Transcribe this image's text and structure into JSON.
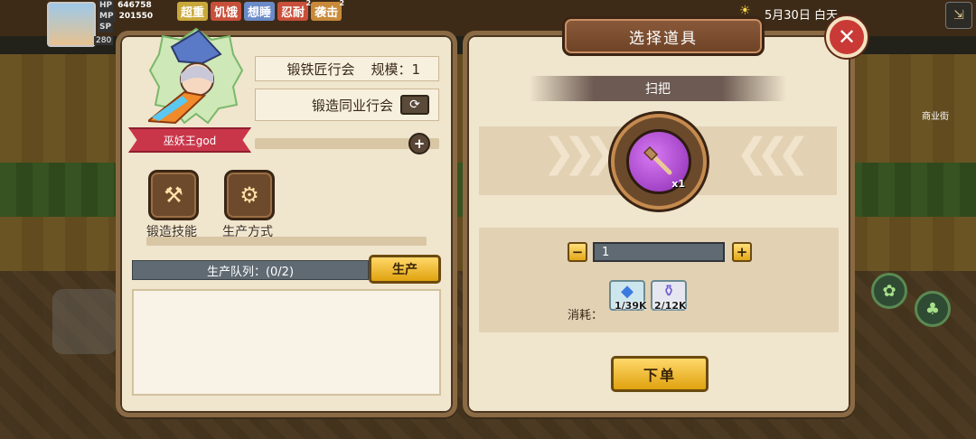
{
  "hud": {
    "hp_label": "HP",
    "hp_value": "646758",
    "mp_label": "MP",
    "mp_value": "201550",
    "sp_label": "SP",
    "level": "280",
    "buffs": [
      {
        "label": "超重",
        "color": "#c8a83a",
        "count": ""
      },
      {
        "label": "饥饿",
        "color": "#c8503a",
        "count": ""
      },
      {
        "label": "想睡",
        "color": "#6a8ac8",
        "count": ""
      },
      {
        "label": "忍耐",
        "color": "#c8503a",
        "count": "2"
      },
      {
        "label": "袭击",
        "color": "#c88a3a",
        "count": "2"
      }
    ],
    "date": "5月30日 白天",
    "street_label": "商业街"
  },
  "left_panel": {
    "guild_name": "锻铁匠行会",
    "scale_label": "规模：1",
    "sub_guild": "锻造同业行会",
    "character_name": "巫妖王god",
    "skills": [
      {
        "label": "锻造技能",
        "icon": "anvil-icon"
      },
      {
        "label": "生产方式",
        "icon": "robot-arm-icon"
      }
    ],
    "queue_label": "生产队列：(0/2)",
    "produce_button": "生产"
  },
  "right_panel": {
    "title": "选择道具",
    "item_name": "扫把",
    "item_icon": "broom-icon",
    "item_count": "x1",
    "quantity": "1",
    "cost_label": "消耗：",
    "costs": [
      {
        "icon": "blue-gem-icon",
        "value": "1/39K"
      },
      {
        "icon": "potion-bottle-icon",
        "value": "2/12K"
      }
    ],
    "order_button": "下单"
  },
  "colors": {
    "panel_bg": "#f0e5cd",
    "panel_border": "#8a6a44",
    "gold_button": "#e0a20f",
    "ribbon_red": "#c9364a",
    "close_red": "#c93a36",
    "item_purple": "#8a2cb3"
  }
}
